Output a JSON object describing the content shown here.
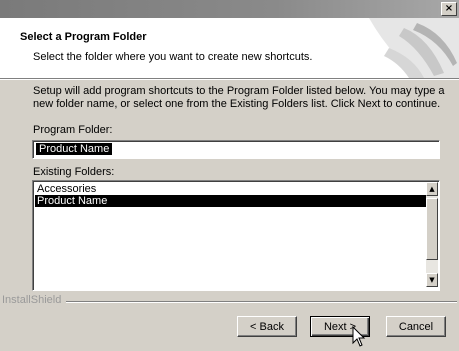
{
  "window": {
    "close_glyph": "×",
    "title_bar_color": "#808080"
  },
  "header": {
    "title": "Select a Program Folder",
    "subtitle": "Select the folder where you want to create new shortcuts."
  },
  "description": "Setup will add program shortcuts to the Program Folder listed below. You may type a new folder name, or select one from the Existing Folders list.  Click Next to continue.",
  "program_folder": {
    "label": "Program Folder:",
    "value": "Product Name"
  },
  "existing_folders": {
    "label": "Existing Folders:",
    "items": [
      {
        "label": "Accessories",
        "selected": false
      },
      {
        "label": "Product Name",
        "selected": true
      }
    ],
    "scroll_up_glyph": "▲",
    "scroll_down_glyph": "▼"
  },
  "branding": "InstallShield",
  "buttons": {
    "back": "< Back",
    "next": "Next >",
    "cancel": "Cancel"
  },
  "icons": [
    "close-icon",
    "header-swoosh-graphic",
    "scroll-up-icon",
    "scroll-down-icon",
    "mouse-pointer-icon"
  ]
}
